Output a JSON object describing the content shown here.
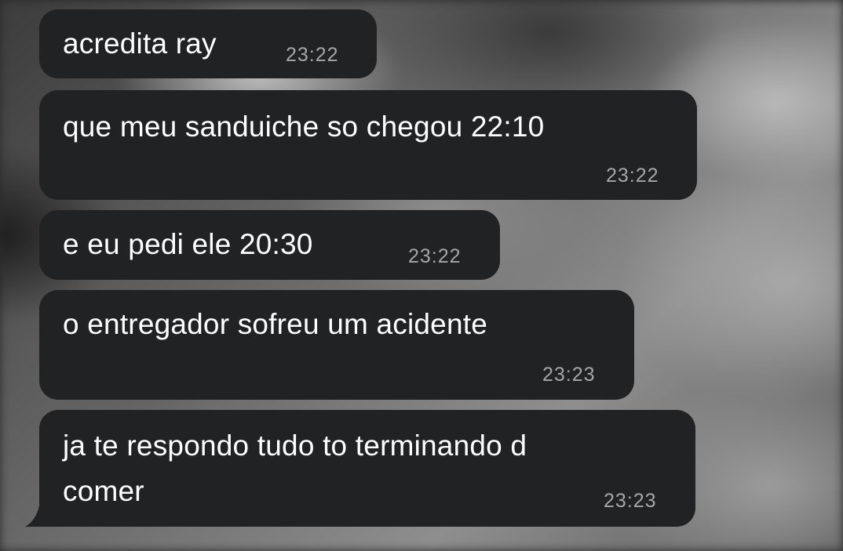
{
  "messages": [
    {
      "text": "acredita ray",
      "time": "23:22"
    },
    {
      "text": "que meu sanduiche so chegou 22:10",
      "time": "23:22"
    },
    {
      "text": "e eu pedi ele 20:30",
      "time": "23:22"
    },
    {
      "text": "o entregador sofreu um acidente",
      "time": "23:23"
    },
    {
      "text_line1": "ja te respondo tudo to terminando d",
      "text_line2": "comer",
      "time": "23:23"
    }
  ],
  "colors": {
    "bubble": "#212223",
    "text": "#ffffff",
    "timestamp": "#a6a6a8"
  }
}
